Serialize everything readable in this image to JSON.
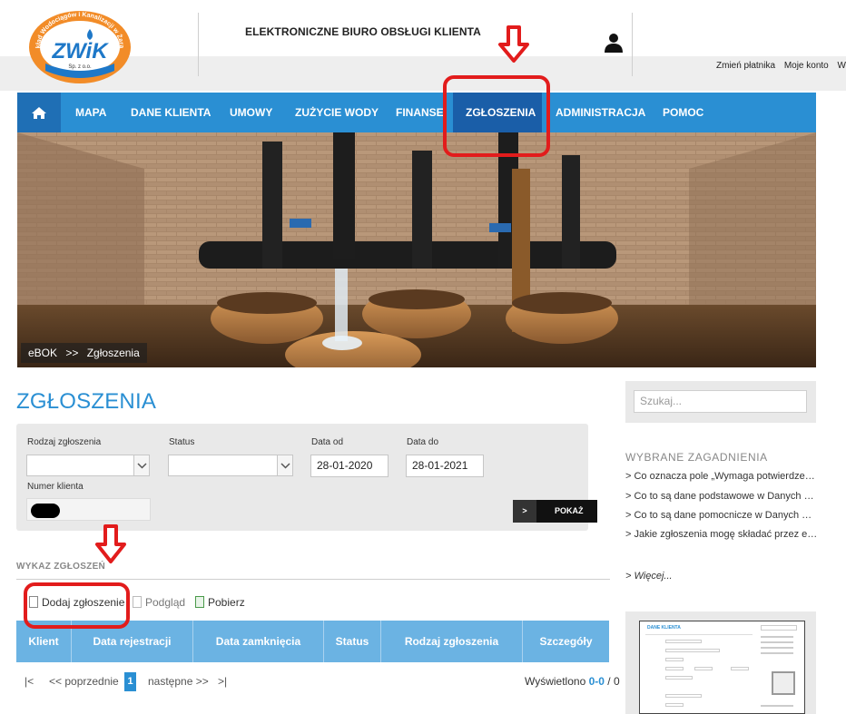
{
  "header": {
    "title": "ELEKTRONICZNE BIURO OBSŁUGI KLIENTA",
    "links": [
      "Zmień płatnika",
      "Moje konto",
      "Wyloguj"
    ]
  },
  "logo": {
    "text": "ZWiK",
    "arc_text": "Zakład Wodociągów i Kanalizacji w Żarach",
    "sub": "Sp. z o.o."
  },
  "nav": {
    "items": [
      "MAPA",
      "DANE KLIENTA",
      "UMOWY",
      "ZUŻYCIE WODY",
      "FINANSE",
      "ZGŁOSZENIA",
      "ADMINISTRACJA",
      "POMOC"
    ],
    "active": "ZGŁOSZENIA"
  },
  "breadcrumb": {
    "root": "eBOK",
    "sep": ">>",
    "current": "Zgłoszenia"
  },
  "main": {
    "title": "ZGŁOSZENIA",
    "filters": {
      "type_label": "Rodzaj zgłoszenia",
      "status_label": "Status",
      "date_from_label": "Data od",
      "date_from": "28-01-2020",
      "date_to_label": "Data do",
      "date_to": "28-01-2021",
      "client_label": "Numer klienta",
      "button_arrow": ">",
      "button_label": "POKAŻ"
    },
    "list_title": "WYKAZ ZGŁOSZEŃ",
    "toolbar": {
      "add": "Dodaj zgłoszenie",
      "preview": "Podgląd",
      "download": "Pobierz"
    },
    "columns": [
      "Klient",
      "Data rejestracji",
      "Data zamknięcia",
      "Status",
      "Rodzaj zgłoszenia",
      "Szczegóły"
    ],
    "pager": {
      "first": "|<",
      "prev": "<< poprzednie",
      "page": "1",
      "next": "następne >>",
      "last": ">|",
      "shown_label": "Wyświetlono",
      "shown_range": "0-0",
      "shown_sep": "/",
      "shown_total": "0"
    }
  },
  "sidebar": {
    "search_placeholder": "Szukaj...",
    "section_title": "WYBRANE ZAGADNIENIA",
    "links": [
      "> Co oznacza pole „Wymaga potwierdzenia Z...",
      "> Co to są dane podstawowe w Danych Klien...",
      "> Co to są dane pomocnicze w Danych Klient...",
      "> Jakie zgłoszenia mogę składać przez e-Bok?"
    ],
    "more": "> Więcej...",
    "thumb_title": "DANE KLIENTA"
  },
  "colors": {
    "accent": "#2a8fd3",
    "nav_active": "#1a5ea8",
    "annotation": "#e21c1c"
  }
}
